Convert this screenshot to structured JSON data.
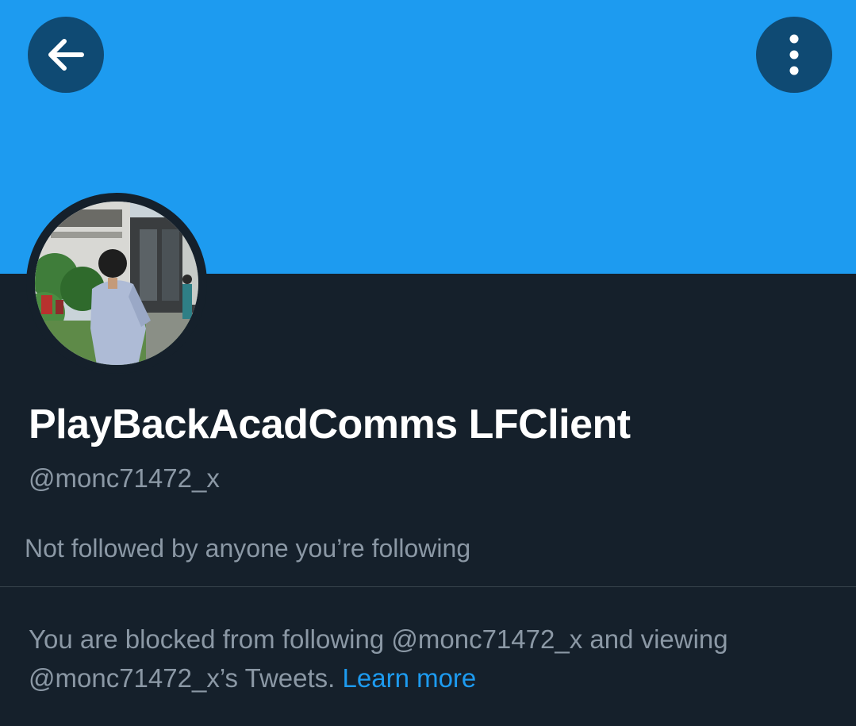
{
  "header": {
    "back_icon": "arrow-left-icon",
    "more_icon": "more-vertical-icon",
    "banner_color": "#1d9bf0",
    "button_bg_color": "#0f4a73"
  },
  "profile": {
    "display_name": "PlayBackAcadComms LFClient",
    "handle": "@monc71472_x",
    "followers_note": "Not followed by anyone you’re following"
  },
  "blocked": {
    "message": "You are blocked from following @monc71472_x and viewing @monc71472_x’s Tweets.",
    "learn_more_label": "Learn more",
    "link_color": "#1d9bf0"
  },
  "theme": {
    "background": "#15202b",
    "primary_text": "#ffffff",
    "secondary_text": "#8b98a5",
    "divider": "#38444d"
  }
}
